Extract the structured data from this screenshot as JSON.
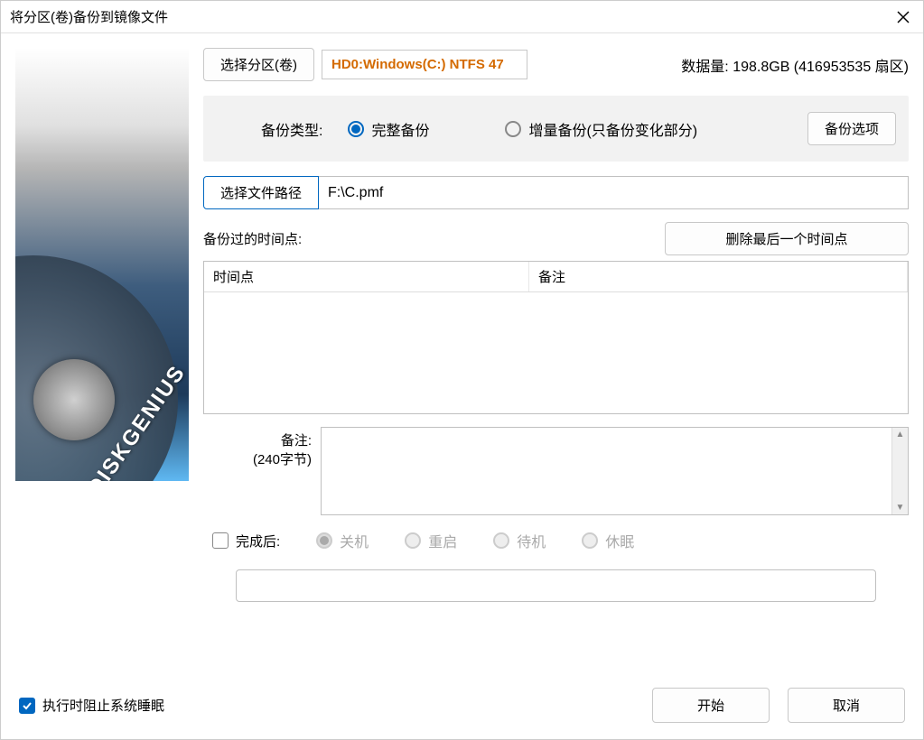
{
  "window": {
    "title": "将分区(卷)备份到镜像文件"
  },
  "sidebar": {
    "brand": "DISKGENIUS"
  },
  "partition": {
    "select_btn": "选择分区(卷)",
    "info": "HD0:Windows(C:) NTFS 47",
    "data_amount_label": "数据量:",
    "data_amount_value": "198.8GB (416953535 扇区)"
  },
  "backup_type": {
    "label": "备份类型:",
    "full": "完整备份",
    "incremental": "增量备份(只备份变化部分)",
    "options_btn": "备份选项"
  },
  "file_path": {
    "select_btn": "选择文件路径",
    "value": "F:\\C.pmf"
  },
  "history": {
    "label": "备份过的时间点:",
    "delete_btn": "删除最后一个时间点",
    "col_time": "时间点",
    "col_remark": "备注"
  },
  "remark": {
    "label": "备注:",
    "hint": "(240字节)"
  },
  "after_done": {
    "label": "完成后:",
    "shutdown": "关机",
    "restart": "重启",
    "standby": "待机",
    "hibernate": "休眠"
  },
  "footer": {
    "prevent_sleep": "执行时阻止系统睡眠",
    "start": "开始",
    "cancel": "取消"
  }
}
